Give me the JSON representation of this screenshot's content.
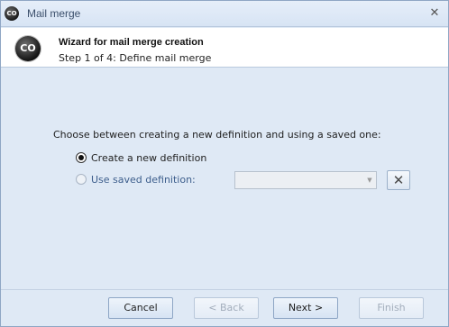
{
  "window": {
    "title": "Mail merge",
    "app_icon_text": "CO",
    "close_glyph": "✕"
  },
  "header": {
    "logo_text": "CO",
    "title": "Wizard for mail merge creation",
    "step": "Step 1 of 4: Define mail merge"
  },
  "main": {
    "prompt": "Choose between creating a new definition and using a saved one:",
    "options": [
      {
        "label": "Create a new definition",
        "checked": true,
        "enabled": true
      },
      {
        "label": "Use saved definition:",
        "checked": false,
        "enabled": false
      }
    ],
    "saved_definition": {
      "value": ""
    },
    "clear_icon": "x-icon"
  },
  "footer": {
    "cancel_label": "Cancel",
    "back_label": "< Back",
    "next_label": "Next >",
    "finish_label": "Finish"
  },
  "colors": {
    "background": "#dfe9f5",
    "header_bg": "#ffffff",
    "border": "#8fa6c4",
    "disabled_text": "#a2adbb"
  }
}
